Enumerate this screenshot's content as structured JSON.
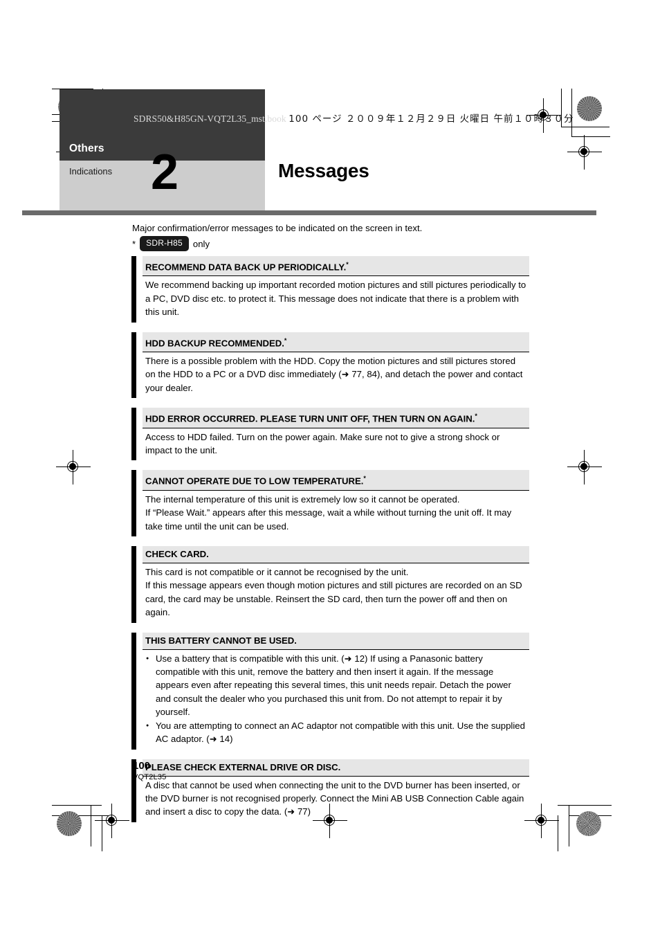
{
  "print_header": {
    "filename": "SDRS50&H85GN-VQT2L35_mst.book",
    "japanese_info": "100 ページ  ２００９年１２月２９日  火曜日  午前１０時３０分"
  },
  "tab": {
    "section": "Others",
    "subsection": "Indications",
    "number": "2"
  },
  "page_title": "Messages",
  "intro": {
    "line1": "Major confirmation/error messages to be indicated on the screen in text.",
    "asterisk": "*",
    "model_badge": "SDR-H85",
    "only": "only"
  },
  "messages": [
    {
      "title": "RECOMMEND DATA BACK UP PERIODICALLY.",
      "starred": true,
      "body": "We recommend backing up important recorded motion pictures and still pictures periodically to a PC, DVD disc etc. to protect it. This message does not indicate that there is a problem with this unit."
    },
    {
      "title": "HDD BACKUP RECOMMENDED.",
      "starred": true,
      "body": "There is a possible problem with the HDD. Copy the motion pictures and still pictures stored on the HDD to a PC or a DVD disc immediately (➜ 77, 84), and detach the power and contact your dealer."
    },
    {
      "title": "HDD ERROR OCCURRED. PLEASE TURN UNIT OFF, THEN TURN ON AGAIN.",
      "starred": true,
      "body": "Access to HDD failed. Turn on the power again. Make sure not to give a strong shock or impact to the unit."
    },
    {
      "title": "CANNOT OPERATE DUE TO LOW TEMPERATURE.",
      "starred": true,
      "body_line1": "The internal temperature of this unit is extremely low so it cannot be operated.",
      "body_line2": "If “Please Wait.” appears after this message, wait a while without turning the unit off. It may take time until the unit can be used."
    },
    {
      "title": "CHECK CARD.",
      "starred": false,
      "body_line1": "This card is not compatible or it cannot be recognised by the unit.",
      "body_line2": "If this message appears even though motion pictures and still pictures are recorded on an SD card, the card may be unstable. Reinsert the SD card, then turn the power off and then on again."
    },
    {
      "title": "THIS BATTERY CANNOT BE USED.",
      "starred": false,
      "bullets": [
        "Use a battery that is compatible with this unit. (➜ 12) If using a Panasonic battery compatible with this unit, remove the battery and then insert it again. If the message appears even after repeating this several times, this unit needs repair. Detach the power and consult the dealer who you purchased this unit from. Do not attempt to repair it by yourself.",
        "You are attempting to connect an AC adaptor not compatible with this unit. Use the supplied AC adaptor. (➜ 14)"
      ]
    },
    {
      "title": "PLEASE CHECK EXTERNAL DRIVE OR DISC.",
      "starred": false,
      "body": "A disc that cannot be used when connecting the unit to the DVD burner has been inserted, or the DVD burner is not recognised properly. Connect the Mini AB USB Connection Cable again and insert a disc to copy the data. (➜ 77)"
    }
  ],
  "footer": {
    "page_number": "100",
    "doc_code": "VQT2L35"
  },
  "colors": {
    "tab_dark": "#3b3b3b",
    "tab_light": "#cdcdcd",
    "rule": "#6b6b6b",
    "msg_header": "#e6e6e6",
    "msg_bar": "#000000"
  }
}
